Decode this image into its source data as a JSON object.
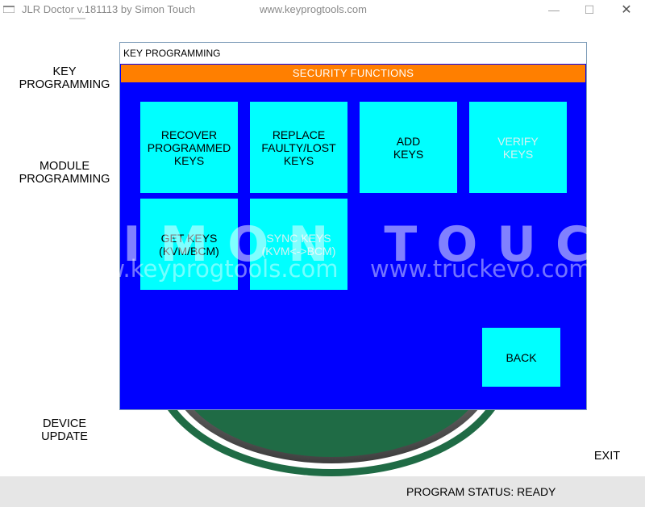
{
  "window": {
    "title": "JLR Doctor v.181113 by Simon Touch",
    "url": "www.keyprogtools.com",
    "minimize_glyph": "—",
    "maximize_glyph": "☐",
    "close_glyph": "✕",
    "icon": "app-window-icon"
  },
  "side_menu": {
    "key_programming": "KEY\nPROGRAMMING",
    "module_programming": "MODULE\nPROGRAMMING",
    "device_update": "DEVICE\nUPDATE",
    "exit": "EXIT"
  },
  "dialog": {
    "title": "KEY PROGRAMMING",
    "header": "SECURITY FUNCTIONS",
    "buttons": [
      {
        "label": "RECOVER\nPROGRAMMED\nKEYS",
        "enabled": true
      },
      {
        "label": "REPLACE\nFAULTY/LOST\nKEYS",
        "enabled": true
      },
      {
        "label": "ADD\nKEYS",
        "enabled": true
      },
      {
        "label": "VERIFY\nKEYS",
        "enabled": false
      },
      {
        "label": "GET KEYS\n(KVM/BCM)",
        "enabled": true
      },
      {
        "label": "SYNC KEYS\n(KVM<->BCM)",
        "enabled": false
      },
      {
        "label": "BACK",
        "enabled": true
      }
    ]
  },
  "watermark": {
    "name": "SIMON TOUCH",
    "url_left": "www.keyprogtools.com",
    "url_right": "www.truckevo.com"
  },
  "status": {
    "text": "PROGRAM STATUS: READY"
  },
  "colors": {
    "dialog_bg": "#0000ff",
    "header_bg": "#ff7f00",
    "tile_bg": "#00ffff",
    "status_bg": "#e6e6e6"
  }
}
